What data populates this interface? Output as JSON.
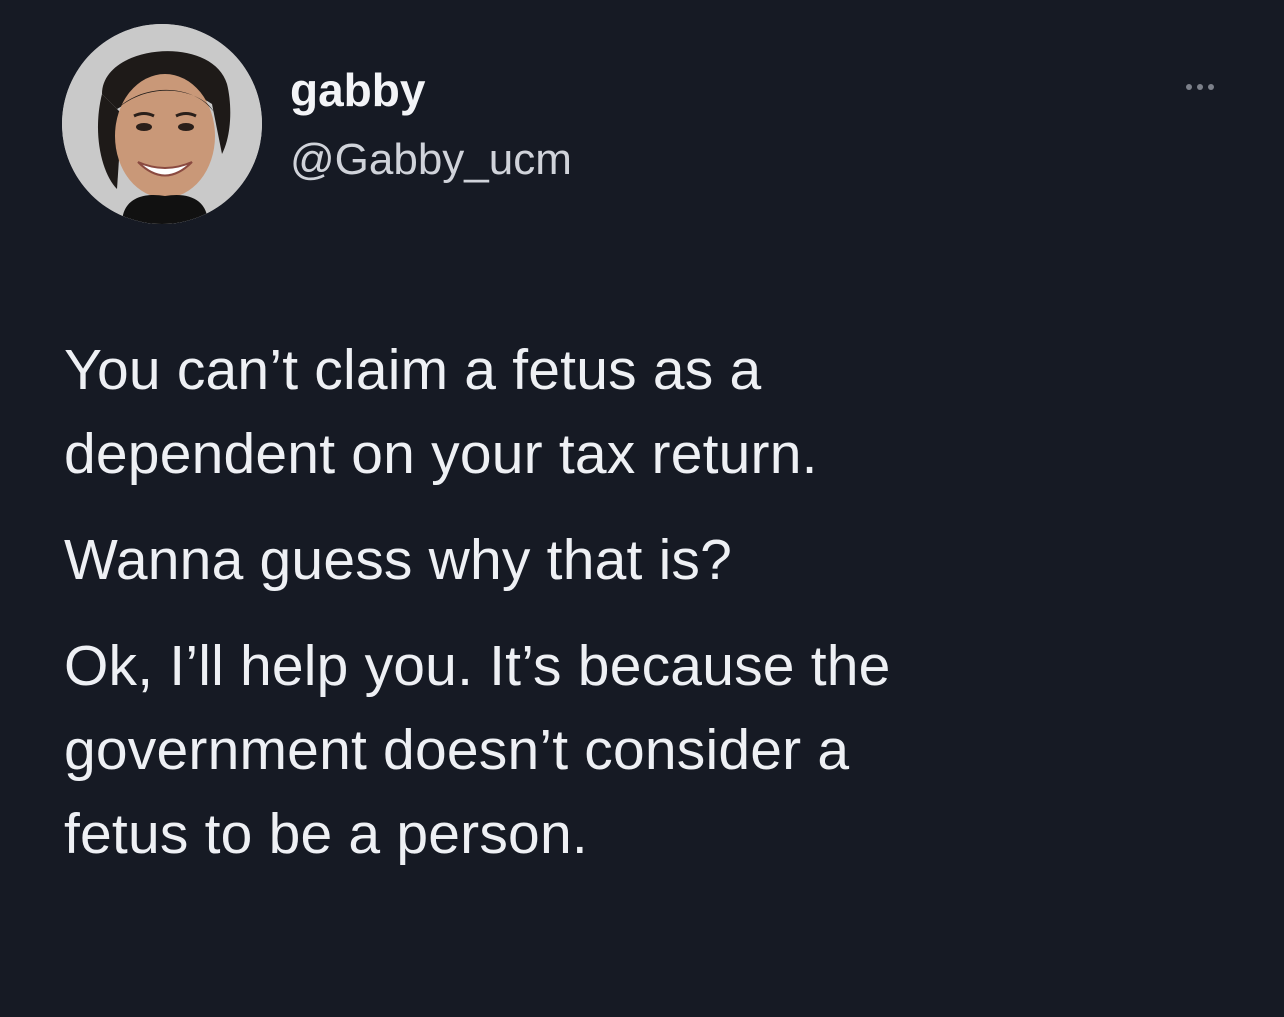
{
  "author": {
    "display_name": "gabby",
    "handle": "@Gabby_ucm"
  },
  "icons": {
    "avatar": "profile-photo",
    "more": "more-options-icon"
  },
  "colors": {
    "background": "#161a24",
    "text": "#eef0f4",
    "secondary_text": "#d0d3da"
  },
  "tweet": {
    "paragraphs": [
      {
        "lines": [
          "You can’t claim a fetus as a",
          "dependent on your tax return."
        ]
      },
      {
        "lines": [
          "Wanna guess why that is?"
        ]
      },
      {
        "lines": [
          "Ok, I’ll help you. It’s because the",
          "government doesn’t consider a",
          "fetus to be a person."
        ]
      }
    ]
  }
}
